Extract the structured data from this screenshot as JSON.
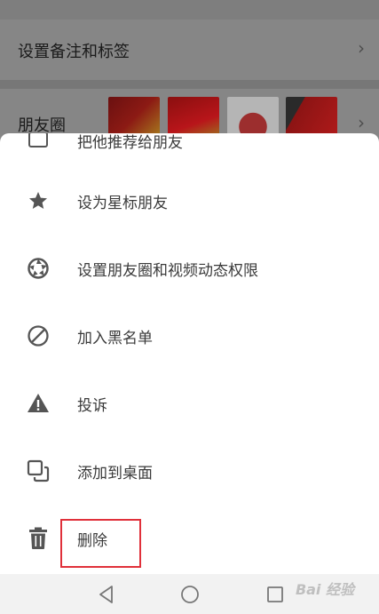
{
  "background": {
    "remark_label": "设置备注和标签",
    "moments_label": "朋友圈",
    "chevron": "›"
  },
  "menu": {
    "partial_item": "把他推荐给朋友",
    "items": [
      {
        "label": "设为星标朋友",
        "icon": "star-icon"
      },
      {
        "label": "设置朋友圈和视频动态权限",
        "icon": "aperture-icon"
      },
      {
        "label": "加入黑名单",
        "icon": "block-icon"
      },
      {
        "label": "投诉",
        "icon": "warning-icon"
      },
      {
        "label": "添加到桌面",
        "icon": "add-to-desktop-icon"
      },
      {
        "label": "删除",
        "icon": "trash-icon"
      }
    ]
  },
  "highlight_color": "#e0303a",
  "watermark": "Bai 经验"
}
